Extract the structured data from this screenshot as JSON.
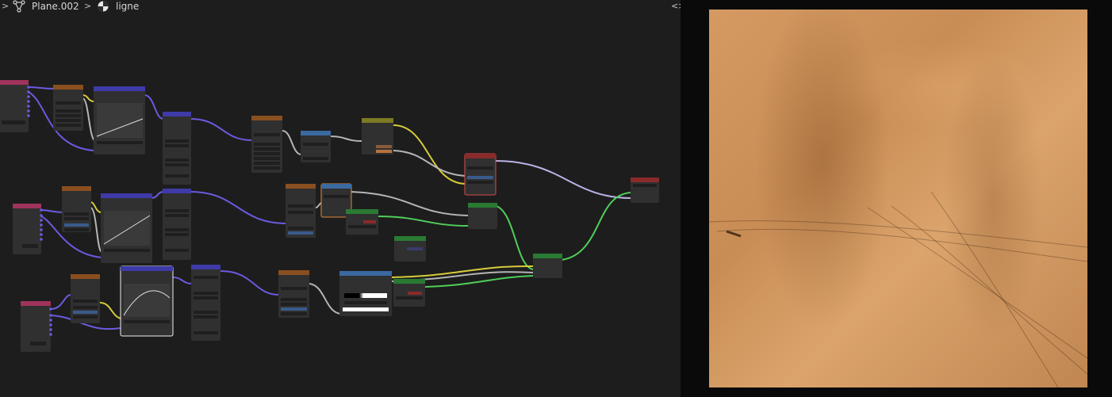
{
  "header": {
    "object_name": "Plane.002",
    "material_name": "ligne",
    "object_icon": "mesh-icon",
    "material_icon": "material-sphere-icon",
    "expand_icon": "chevron-right-icon",
    "breadcrumb_sep_icon": "chevron-right-icon",
    "split_icon": "split-arrows-icon"
  },
  "colors": {
    "editor_bg": "#1d1d1d",
    "node_body": "#303030",
    "texcoord_header": "#a0335c",
    "vector_header": "#8a4f1f",
    "converter_header": "#3e3aa8",
    "color_header": "#7c7a24",
    "shader_header": "#2a7a33",
    "output_header": "#8a2a2a",
    "link_purple": "#6a5be0",
    "link_yellow": "#d6cc3a",
    "link_gray": "#b5b5b5",
    "link_green": "#4fcf5a",
    "render_base": "#d49a62"
  }
}
